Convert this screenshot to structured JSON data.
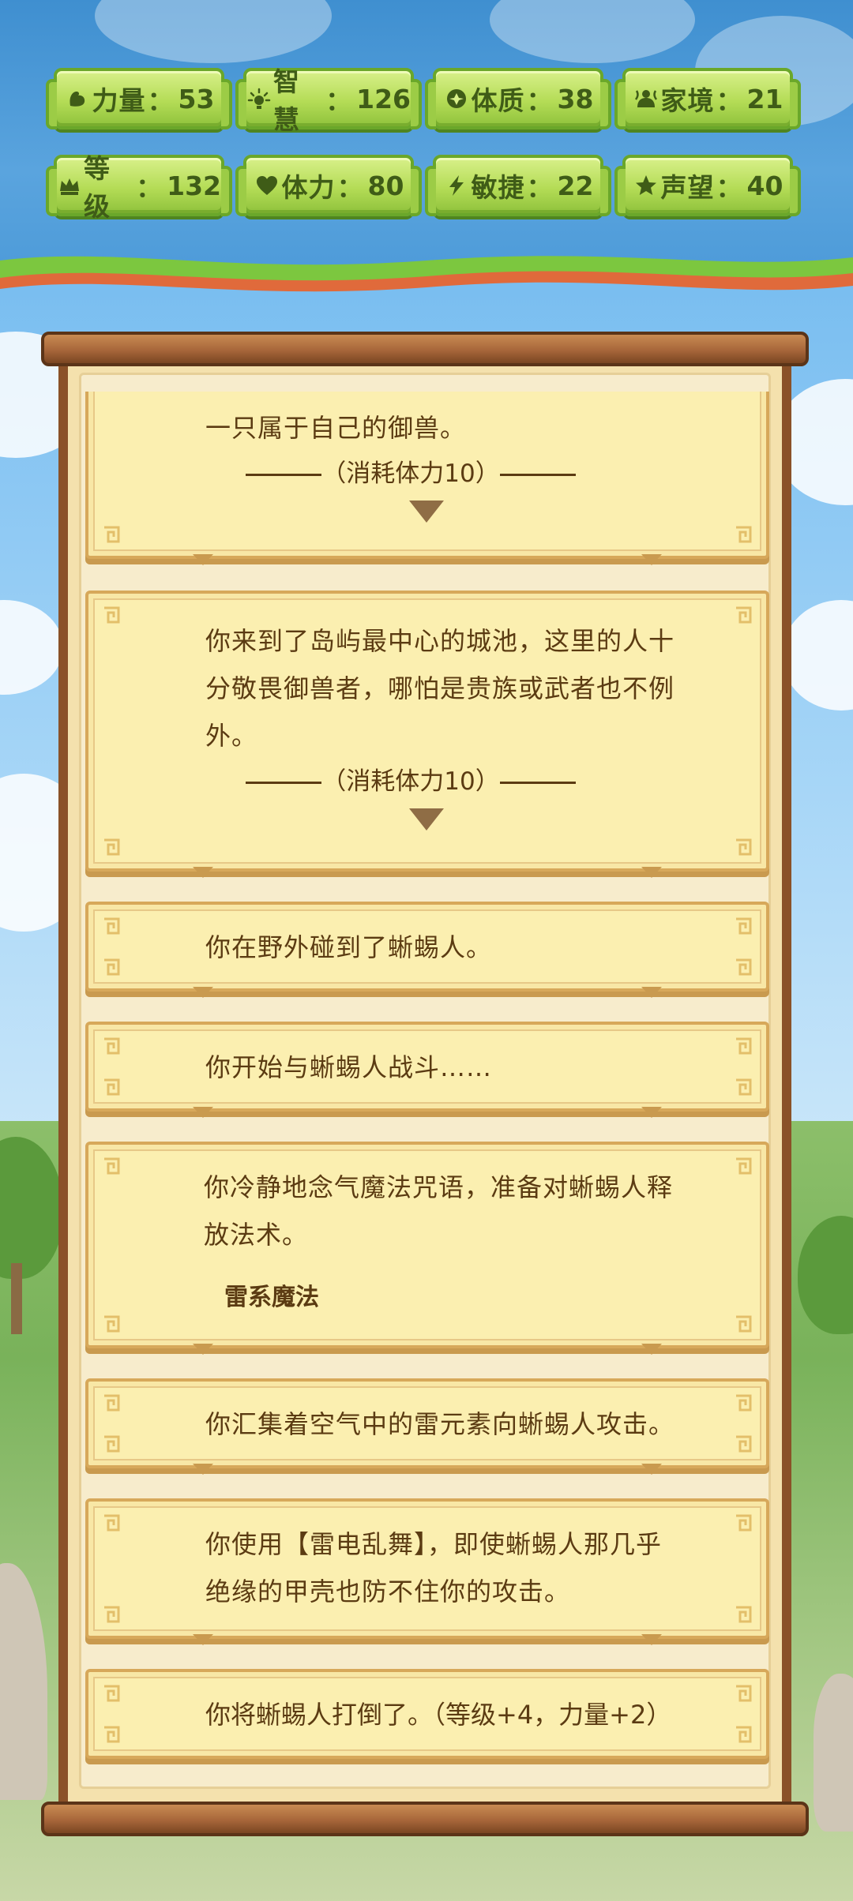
{
  "stats": [
    {
      "icon": "strength-icon",
      "label": "力量",
      "value": "53"
    },
    {
      "icon": "wisdom-icon",
      "label": "智慧",
      "value": "126"
    },
    {
      "icon": "constitution-icon",
      "label": "体质",
      "value": "38"
    },
    {
      "icon": "family-icon",
      "label": "家境",
      "value": "21"
    },
    {
      "icon": "crown-icon",
      "label": "等级",
      "value": "132"
    },
    {
      "icon": "heart-icon",
      "label": "体力",
      "value": "80"
    },
    {
      "icon": "lightning-icon",
      "label": "敏捷",
      "value": "22"
    },
    {
      "icon": "star-icon",
      "label": "声望",
      "value": "40"
    }
  ],
  "separator": "：",
  "events": [
    {
      "lines": [
        "一只属于自己的御兽。"
      ],
      "cost": "（消耗体力10）",
      "expandable": true
    },
    {
      "lines": [
        "你来到了岛屿最中心的城池，这里的人十",
        "分敬畏御兽者，哪怕是贵族或武者也不例",
        "外。"
      ],
      "cost": "（消耗体力10）",
      "expandable": true
    },
    {
      "lines": [
        "你在野外碰到了蜥蜴人。"
      ]
    },
    {
      "lines": [
        "你开始与蜥蜴人战斗……"
      ]
    },
    {
      "lines": [
        "你冷静地念气魔法咒语，准备对蜥蜴人释",
        "放法术。"
      ],
      "skill": "雷系魔法"
    },
    {
      "lines": [
        "你汇集着空气中的雷元素向蜥蜴人攻击。"
      ]
    },
    {
      "lines": [
        "你使用【雷电乱舞】，即使蜥蜴人那几乎",
        "绝缘的甲壳也防不住你的攻击。"
      ]
    },
    {
      "lines": [
        "你将蜥蜴人打倒了。（等级+4，力量+2）"
      ]
    }
  ],
  "colors": {
    "badge_green": "#b4dc56",
    "card": "#fbefb0",
    "text": "#5b3b12",
    "scroll_wood": "#8a5128"
  }
}
